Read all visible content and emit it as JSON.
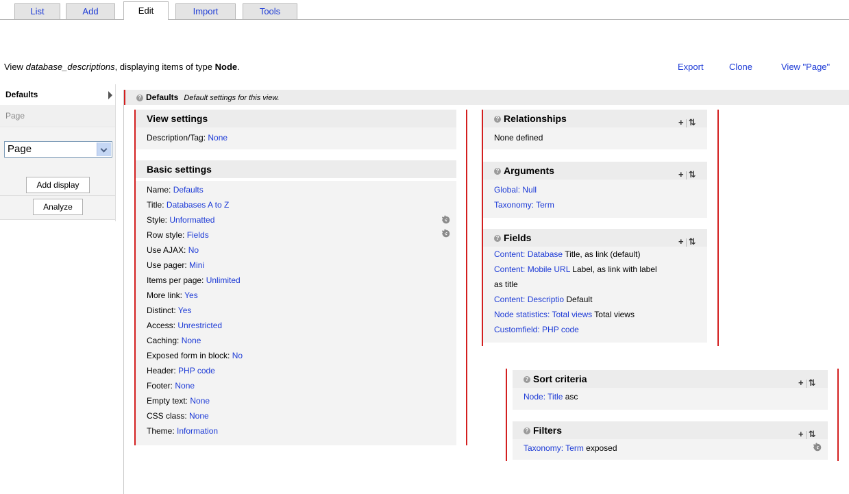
{
  "tabs": [
    "List",
    "Add",
    "Edit",
    "Import",
    "Tools"
  ],
  "header": {
    "view_prefix": "View ",
    "view_name": "database_descriptions",
    "view_mid": ", displaying items of type ",
    "view_type": "Node",
    "view_end": ".",
    "links": [
      "Export",
      "Clone",
      "View \"Page\""
    ]
  },
  "sidebar": {
    "defaults": "Defaults",
    "page": "Page",
    "display_select": "Page",
    "add_display": "Add display",
    "analyze": "Analyze"
  },
  "defaults_bar": {
    "title": "Defaults",
    "description": "Default settings for this view."
  },
  "view_settings": {
    "title": "View settings",
    "rows": [
      {
        "label": "Description/Tag: ",
        "value": "None"
      }
    ]
  },
  "basic_settings": {
    "title": "Basic settings",
    "rows": [
      {
        "label": "Name: ",
        "value": "Defaults"
      },
      {
        "label": "Title: ",
        "value": "Databases A to Z"
      },
      {
        "label": "Style: ",
        "value": "Unformatted"
      },
      {
        "label": "Row style: ",
        "value": "Fields"
      },
      {
        "label": "Use AJAX: ",
        "value": "No"
      },
      {
        "label": "Use pager: ",
        "value": "Mini"
      },
      {
        "label": "Items per page: ",
        "value": "Unlimited"
      },
      {
        "label": "More link: ",
        "value": "Yes"
      },
      {
        "label": "Distinct: ",
        "value": "Yes"
      },
      {
        "label": "Access: ",
        "value": "Unrestricted"
      },
      {
        "label": "Caching: ",
        "value": "None"
      },
      {
        "label": "Exposed form in block: ",
        "value": "No"
      },
      {
        "label": "Header: ",
        "value": "PHP code"
      },
      {
        "label": "Footer: ",
        "value": "None"
      },
      {
        "label": "Empty text: ",
        "value": "None"
      },
      {
        "label": "CSS class: ",
        "value": "None"
      },
      {
        "label": "Theme: ",
        "value": "Information"
      }
    ]
  },
  "relationships": {
    "title": "Relationships",
    "empty": "None defined"
  },
  "arguments": {
    "title": "Arguments",
    "items": [
      "Global: Null",
      "Taxonomy: Term"
    ]
  },
  "fields": {
    "title": "Fields",
    "items": [
      {
        "link": "Content: Database",
        "text": " Title, as link (default)"
      },
      {
        "link": "Content: Mobile URL",
        "text": " Label, as link with label"
      },
      {
        "link": "",
        "text": "as title"
      },
      {
        "link": "Content: Descriptio",
        "text": " Default"
      },
      {
        "link": "Node statistics: Total views",
        "text": " Total views"
      },
      {
        "link": "Customfield: PHP code",
        "text": ""
      }
    ]
  },
  "sort_criteria": {
    "title": "Sort criteria",
    "item_link": "Node: Title",
    "item_text": " asc"
  },
  "filters": {
    "title": "Filters",
    "item_link": "Taxonomy: Term",
    "item_text": " exposed"
  },
  "ops": {
    "add": "+",
    "rearrange": "⇅"
  }
}
